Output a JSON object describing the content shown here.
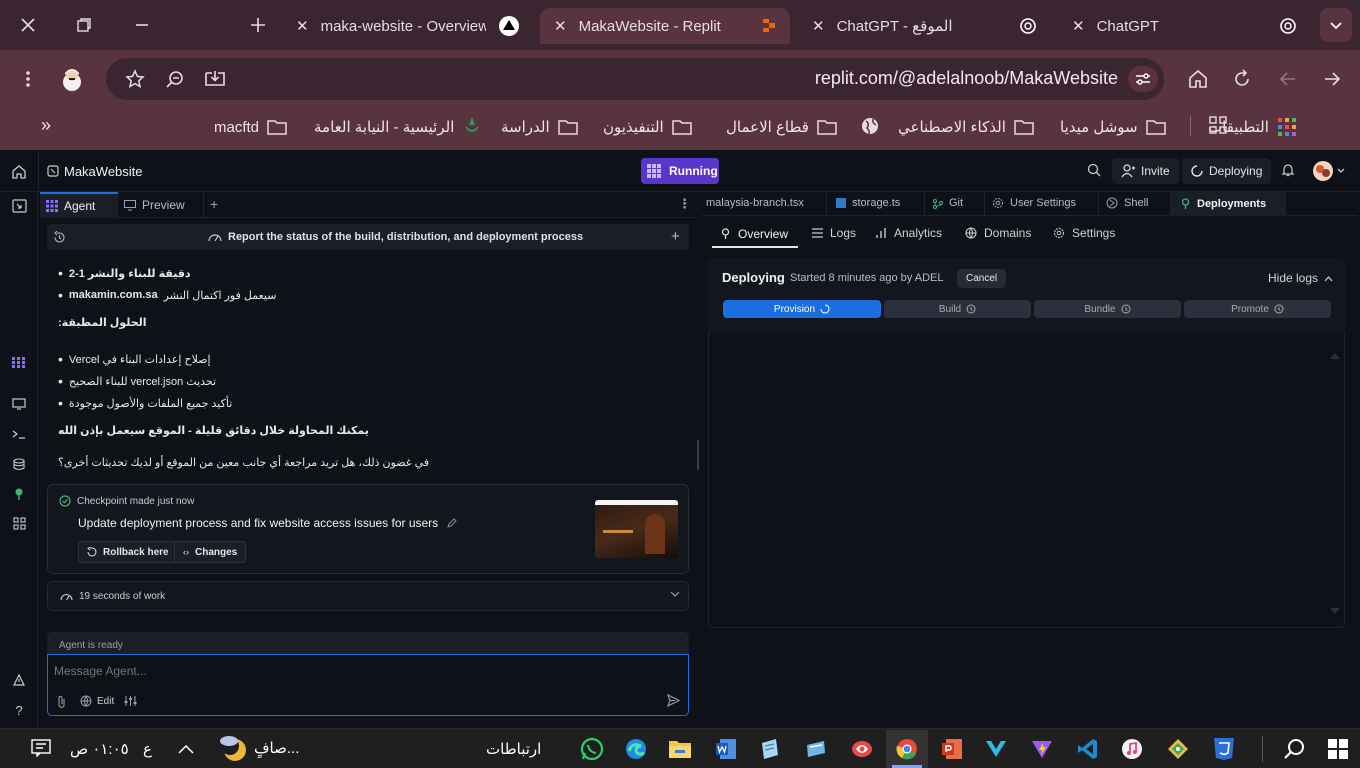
{
  "browser": {
    "tabs": [
      {
        "label": "maka-website - Overview"
      },
      {
        "label": "MakaWebsite - Replit"
      },
      {
        "label": "ChatGPT - الموقع"
      },
      {
        "label": "ChatGPT"
      }
    ],
    "url": "replit.com/@adelalnoob/MakaWebsite",
    "bookmarks": [
      "التطبيقات",
      "سوشل ميديا",
      "الذكاء الاصطناعي",
      "قطاع الاعمال",
      "التنفيذيون",
      "الدراسة",
      "الرئيسية - النيابة العامة",
      "macftd"
    ]
  },
  "replit": {
    "project": "MakaWebsite",
    "status": "Running",
    "invite": "Invite",
    "deploying": "Deploying",
    "left_tabs": [
      "Agent",
      "Preview"
    ],
    "right_tabs": [
      "malaysia-branch.tsx",
      "storage.ts",
      "Git",
      "User Settings",
      "Shell",
      "Deployments"
    ],
    "thread_title": "Report the status of the build, distribution, and deployment process",
    "messages": {
      "b1": "دقيقة للبناء والنشر 1-2",
      "b2_bold": "makamin.com.sa",
      "b2": " سيعمل فور اكتمال النشر",
      "h1": "الحلول المطبقة:",
      "s1": "إصلاح إعدادات البناء في Vercel",
      "s2": "تحديث vercel.json للبناء الصحيح",
      "s3": "تأكيد جميع الملفات والأصول موجودة",
      "p1": "يمكنك المحاولة خلال دقائق قليلة - الموقع سيعمل بإذن الله",
      "p2": "في غضون ذلك، هل تريد مراجعة أي جانب معين من الموقع أو لديك تحديثات أخرى؟"
    },
    "checkpoint": {
      "label": "Checkpoint made just now",
      "title": "Update deployment process and fix website access issues for users",
      "rollback": "Rollback here",
      "changes": "Changes"
    },
    "work": "19 seconds of work",
    "agent_ready": "Agent is ready",
    "input_placeholder": "Message Agent...",
    "edit": "Edit",
    "deploy_nav": [
      "Overview",
      "Logs",
      "Analytics",
      "Domains",
      "Settings"
    ],
    "deploy": {
      "title": "Deploying",
      "started": "Started 8 minutes ago by ADEL",
      "cancel": "Cancel",
      "hide_logs": "Hide logs",
      "steps": [
        "Provision",
        "Build",
        "Bundle",
        "Promote"
      ],
      "provision_progress": 1.0
    }
  },
  "taskbar": {
    "time": "٠١:٠٥ ص",
    "lang": "ع",
    "weather": "صافٍ...",
    "connections": "ارتباطات"
  },
  "colors": {
    "accent": "#1a6ee0",
    "running": "#5a35c9",
    "tab_active": "#59343f"
  }
}
